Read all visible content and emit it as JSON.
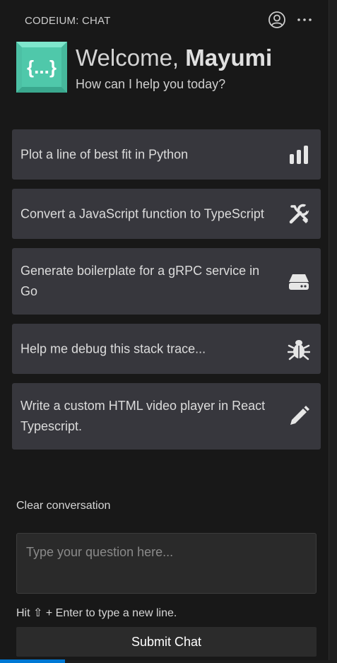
{
  "header": {
    "title": "CODEIUM: CHAT",
    "account_icon": "account-circle-icon",
    "more_icon": "more-horizontal-icon"
  },
  "welcome": {
    "logo_text": "{...}",
    "greeting": "Welcome,",
    "name": "Mayumi",
    "subtitle": "How can I help you today?"
  },
  "suggestions": [
    {
      "label": "Plot a line of best fit in Python",
      "icon": "bar-chart-icon"
    },
    {
      "label": "Convert a JavaScript function to TypeScript",
      "icon": "tools-icon"
    },
    {
      "label": "Generate boilerplate for a gRPC service in Go",
      "icon": "server-drive-icon"
    },
    {
      "label": "Help me debug this stack trace...",
      "icon": "bug-icon"
    },
    {
      "label": "Write a custom HTML video player in React Typescript.",
      "icon": "pencil-icon"
    }
  ],
  "clear_label": "Clear conversation",
  "input": {
    "placeholder": "Type your question here...",
    "value": ""
  },
  "hint": {
    "prefix": "Hit",
    "key_symbol": "⇧",
    "suffix": "+ Enter to type a new line."
  },
  "submit_label": "Submit Chat",
  "colors": {
    "background": "#181818",
    "card": "#37373d",
    "logo": "#5fd4b8",
    "accent": "#0078d4"
  }
}
